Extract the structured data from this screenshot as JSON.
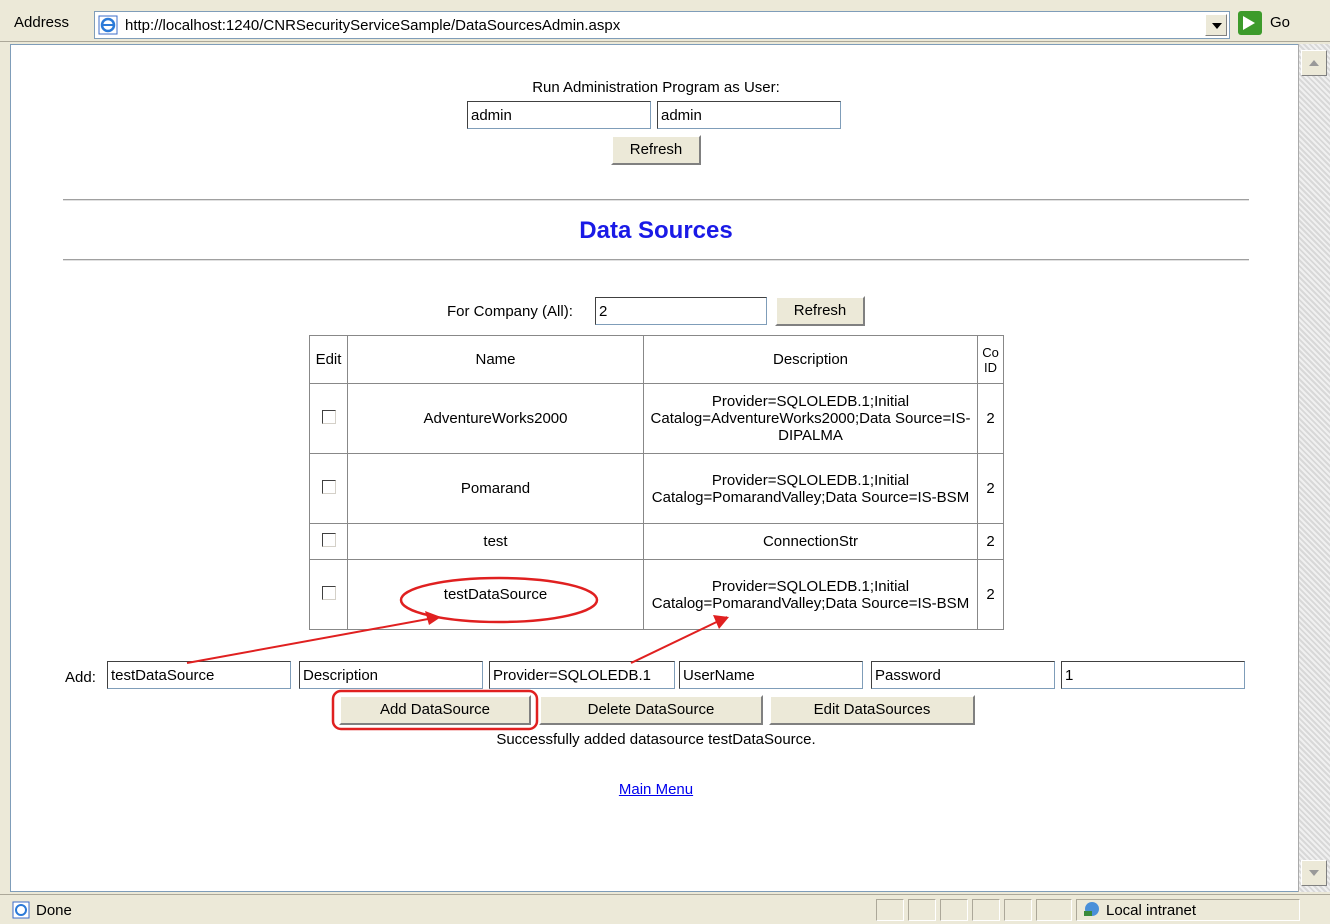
{
  "browser": {
    "address_label": "Address",
    "url": "http://localhost:1240/CNRSecurityServiceSample/DataSourcesAdmin.aspx",
    "go_label": "Go",
    "status_text": "Done",
    "zone_text": "Local intranet"
  },
  "runas": {
    "label": "Run Administration Program as User:",
    "username_value": "admin",
    "password_value": "admin",
    "refresh_label": "Refresh"
  },
  "heading": "Data Sources",
  "company": {
    "label": "For Company (All):",
    "value": "2",
    "refresh_label": "Refresh"
  },
  "table": {
    "headers": {
      "edit": "Edit",
      "name": "Name",
      "description": "Description",
      "coid": "Co ID"
    },
    "rows": [
      {
        "name": "AdventureWorks2000",
        "description": "Provider=SQLOLEDB.1;Initial Catalog=AdventureWorks2000;Data Source=IS-DIPALMA",
        "coid": "2"
      },
      {
        "name": "Pomarand",
        "description": "Provider=SQLOLEDB.1;Initial Catalog=PomarandValley;Data Source=IS-BSM",
        "coid": "2"
      },
      {
        "name": "test",
        "description": "ConnectionStr",
        "coid": "2"
      },
      {
        "name": "testDataSource",
        "description": "Provider=SQLOLEDB.1;Initial Catalog=PomarandValley;Data Source=IS-BSM",
        "coid": "2"
      }
    ]
  },
  "add_form": {
    "label": "Add:",
    "name_value": "testDataSource",
    "description_value": "Description",
    "connection_value": "Provider=SQLOLEDB.1",
    "username_value": "UserName",
    "password_value": "Password",
    "company_value": "1"
  },
  "actions": {
    "add_label": "Add DataSource",
    "delete_label": "Delete DataSource",
    "edit_label": "Edit DataSources"
  },
  "status_message": "Successfully added datasource testDataSource.",
  "main_menu_link": "Main Menu",
  "annotation_color": "#e02020"
}
